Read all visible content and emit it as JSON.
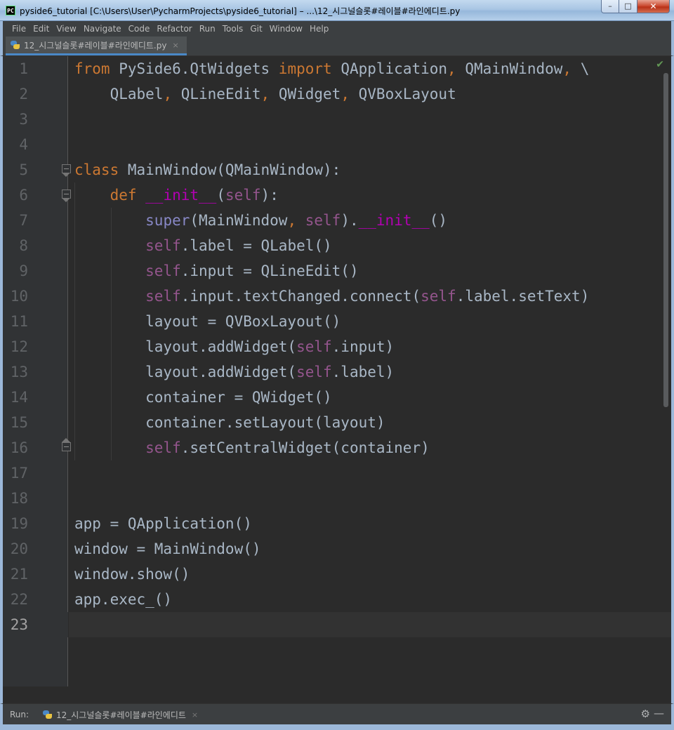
{
  "window": {
    "title": "pyside6_tutorial [C:\\Users\\User\\PycharmProjects\\pyside6_tutorial] – ...\\12_시그널슬롯#레이블#라인에디트.py",
    "app_icon": "PC",
    "minimize": "–",
    "maximize": "□",
    "close": "✕"
  },
  "menu": [
    "File",
    "Edit",
    "View",
    "Navigate",
    "Code",
    "Refactor",
    "Run",
    "Tools",
    "Git",
    "Window",
    "Help"
  ],
  "tab": {
    "label": "12_시그널슬롯#레이블#라인에디트.py",
    "close": "×",
    "icon": "python-file-icon"
  },
  "editor": {
    "inspection_ok": "✔",
    "current_line": 23,
    "line_numbers": [
      "1",
      "2",
      "3",
      "4",
      "5",
      "6",
      "7",
      "8",
      "9",
      "10",
      "11",
      "12",
      "13",
      "14",
      "15",
      "16",
      "17",
      "18",
      "19",
      "20",
      "21",
      "22",
      "23"
    ],
    "code": [
      [
        [
          "kw",
          "from "
        ],
        [
          "",
          "PySide6.QtWidgets "
        ],
        [
          "kw",
          "import "
        ],
        [
          "",
          "QApplication"
        ],
        [
          "kw",
          ", "
        ],
        [
          "",
          "QMainWindow"
        ],
        [
          "kw",
          ", "
        ],
        [
          "",
          "\\"
        ]
      ],
      [
        [
          "",
          "    QLabel"
        ],
        [
          "kw",
          ", "
        ],
        [
          "",
          "QLineEdit"
        ],
        [
          "kw",
          ", "
        ],
        [
          "",
          "QWidget"
        ],
        [
          "kw",
          ", "
        ],
        [
          "",
          "QVBoxLayout"
        ]
      ],
      [],
      [],
      [
        [
          "kw",
          "class "
        ],
        [
          "",
          "MainWindow(QMainWindow):"
        ]
      ],
      [
        [
          "",
          "    "
        ],
        [
          "kw",
          "def "
        ],
        [
          "magic",
          "__init__"
        ],
        [
          "",
          "("
        ],
        [
          "self",
          "self"
        ],
        [
          "",
          "):"
        ]
      ],
      [
        [
          "",
          "        "
        ],
        [
          "builtin",
          "super"
        ],
        [
          "",
          "(MainWindow"
        ],
        [
          "kw",
          ", "
        ],
        [
          "self",
          "self"
        ],
        [
          "",
          ")."
        ],
        [
          "magic",
          "__init__"
        ],
        [
          "",
          "()"
        ]
      ],
      [
        [
          "",
          "        "
        ],
        [
          "self",
          "self"
        ],
        [
          "",
          ".label = QLabel()"
        ]
      ],
      [
        [
          "",
          "        "
        ],
        [
          "self",
          "self"
        ],
        [
          "",
          ".input = QLineEdit()"
        ]
      ],
      [
        [
          "",
          "        "
        ],
        [
          "self",
          "self"
        ],
        [
          "",
          ".input.textChanged.connect("
        ],
        [
          "self",
          "self"
        ],
        [
          "",
          ".label.setText)"
        ]
      ],
      [
        [
          "",
          "        layout = QVBoxLayout()"
        ]
      ],
      [
        [
          "",
          "        layout.addWidget("
        ],
        [
          "self",
          "self"
        ],
        [
          "",
          ".input)"
        ]
      ],
      [
        [
          "",
          "        layout.addWidget("
        ],
        [
          "self",
          "self"
        ],
        [
          "",
          ".label)"
        ]
      ],
      [
        [
          "",
          "        container = QWidget()"
        ]
      ],
      [
        [
          "",
          "        container.setLayout(layout)"
        ]
      ],
      [
        [
          "",
          "        "
        ],
        [
          "self",
          "self"
        ],
        [
          "",
          ".setCentralWidget(container)"
        ]
      ],
      [],
      [],
      [
        [
          "",
          "app = QApplication()"
        ]
      ],
      [
        [
          "",
          "window = MainWindow()"
        ]
      ],
      [
        [
          "",
          "window.show()"
        ]
      ],
      [
        [
          "",
          "app.exec_()"
        ]
      ],
      []
    ]
  },
  "run": {
    "label": "Run:",
    "config": "12_시그널슬롯#레이블#라인에디트",
    "close": "×",
    "settings_icon": "gear-icon",
    "hide_icon": "minimize-icon"
  },
  "colors": {
    "keyword": "#cc7832",
    "self": "#94558d",
    "magic": "#b200b2",
    "builtin": "#8888c6",
    "text": "#a9b7c6",
    "background": "#2b2b2b"
  }
}
